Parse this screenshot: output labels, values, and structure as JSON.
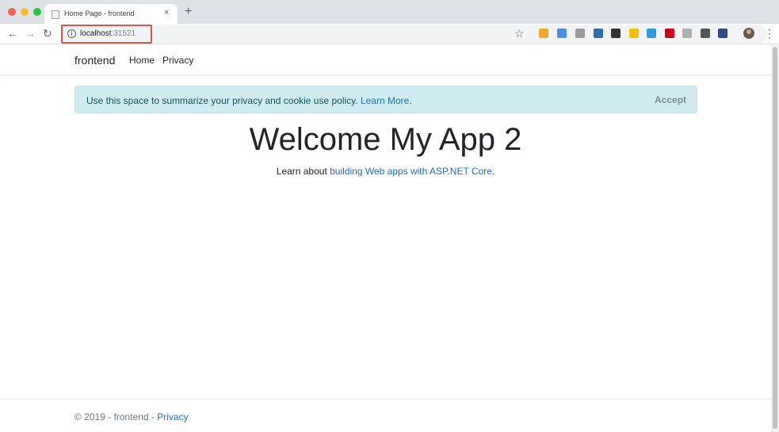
{
  "browser": {
    "tab_title": "Home Page - frontend",
    "tab_close": "×",
    "new_tab": "+",
    "url_host": "localhost",
    "url_port": ":31521",
    "info_glyph": "i",
    "back_glyph": "←",
    "forward_glyph": "→",
    "reload_glyph": "↻",
    "star_glyph": "☆",
    "menu_glyph": "⋮",
    "extension_colors": [
      "#f5a623",
      "#4a90e2",
      "#9b9b9b",
      "#2c6fad",
      "#333333",
      "#f8c000",
      "#2e9cdb",
      "#d0021b",
      "#b0b0b0",
      "#555555",
      "#2d4a8a"
    ]
  },
  "navbar": {
    "brand": "frontend",
    "home": "Home",
    "privacy": "Privacy"
  },
  "cookie": {
    "text": "Use this space to summarize your privacy and cookie use policy.",
    "learn_more": "Learn More",
    "period": ".",
    "accept": "Accept"
  },
  "main": {
    "title": "Welcome My App 2",
    "learn_prefix": "Learn about ",
    "learn_link": "building Web apps with ASP.NET Core",
    "learn_suffix": "."
  },
  "footer": {
    "text": "© 2019 - frontend - ",
    "privacy": "Privacy"
  },
  "colors": {
    "link": "#1b6ec2",
    "alert_bg": "#d1ecf1",
    "alert_text": "#0c5460",
    "highlight_border": "#d9534f"
  }
}
